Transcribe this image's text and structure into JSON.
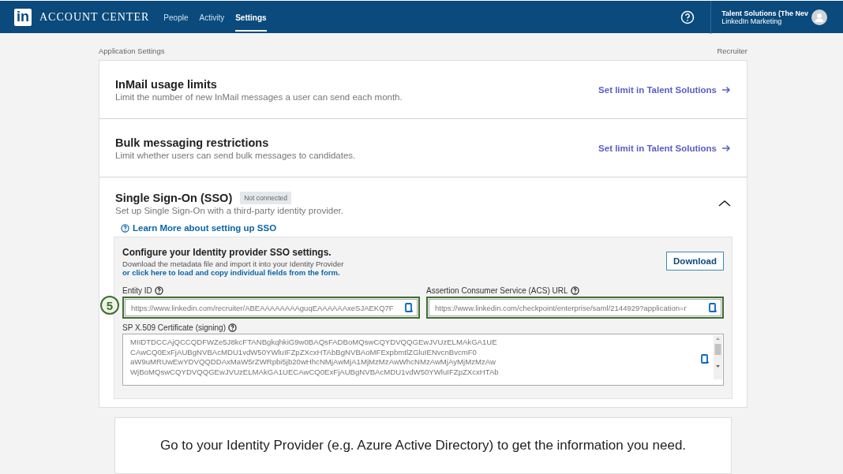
{
  "header": {
    "logo": "in",
    "title": "ACCOUNT CENTER",
    "tabs": [
      {
        "label": "People",
        "selected": false
      },
      {
        "label": "Activity",
        "selected": false
      },
      {
        "label": "Settings",
        "selected": true
      }
    ],
    "account": {
      "name": "Talent Solutions (The Nev",
      "org": "LinkedIn Marketing"
    }
  },
  "breadcrumb": {
    "left": "Application Settings",
    "right": "Recruiter"
  },
  "sections": [
    {
      "title": "InMail usage limits",
      "description": "Limit the number of new InMail messages a user can send each month.",
      "link": "Set limit in Talent Solutions"
    },
    {
      "title": "Bulk messaging restrictions",
      "description": "Limit whether users can send bulk messages to candidates.",
      "link": "Set limit in Talent Solutions"
    }
  ],
  "sso": {
    "title": "Single Sign-On (SSO)",
    "status": "Not connected",
    "description": "Set up Single Sign-On with a third-party identity provider.",
    "expanded": true,
    "learn_more": "Learn More about setting up SSO",
    "panel": {
      "heading": "Configure your Identity provider SSO settings.",
      "instructions": "Download the metadata file and import it into your Identity Provider",
      "link": "or click here to load and copy individual fields from the form.",
      "download": "Download",
      "fields": [
        {
          "label": "Entity ID",
          "value": "https://www.linkedin.com/recruiter/ABEAAAAAAAAguqEAAAAAAxeSJAEKQ7F",
          "highlighted": true,
          "annotation": "5"
        },
        {
          "label": "Assertion Consumer Service (ACS) URL",
          "value": "https://www.linkedin.com/checkpoint/enterprise/saml/2144929?application=r",
          "highlighted": true
        }
      ],
      "certificate": {
        "label": "SP X.509 Certificate (signing)",
        "lines": [
          "MIIDTDCCAjQCCQDFWZe5J8kcFTANBgkqhkiG9w0BAQsFADBoMQswCQYDVQQGEwJVUzELMAkGA1UE",
          "CAwCQ0ExFjAUBgNVBAcMDU1vdW50YWluIFZpZXcxHTAbBgNVBAoMFExpbmtlZGluIENvcnBvcmF0",
          "aW9uMRUwEwYDVQQDDAxMaW5rZWRpbi5jb20wHhcNMjAwMjA1MjMzMzAwWhcNMzAwMjAyMjMzMzAw",
          "WjBoMQswCQYDVQQGEwJVUzELMAkGA1UECAwCQ0ExFjAUBgNVBAcMDU1vdW50YWluIFZpZXcxHTAb"
        ]
      }
    }
  },
  "footer_card": {
    "text": "Go to your Identity Provider (e.g. Azure Active Directory) to get the information you need."
  }
}
